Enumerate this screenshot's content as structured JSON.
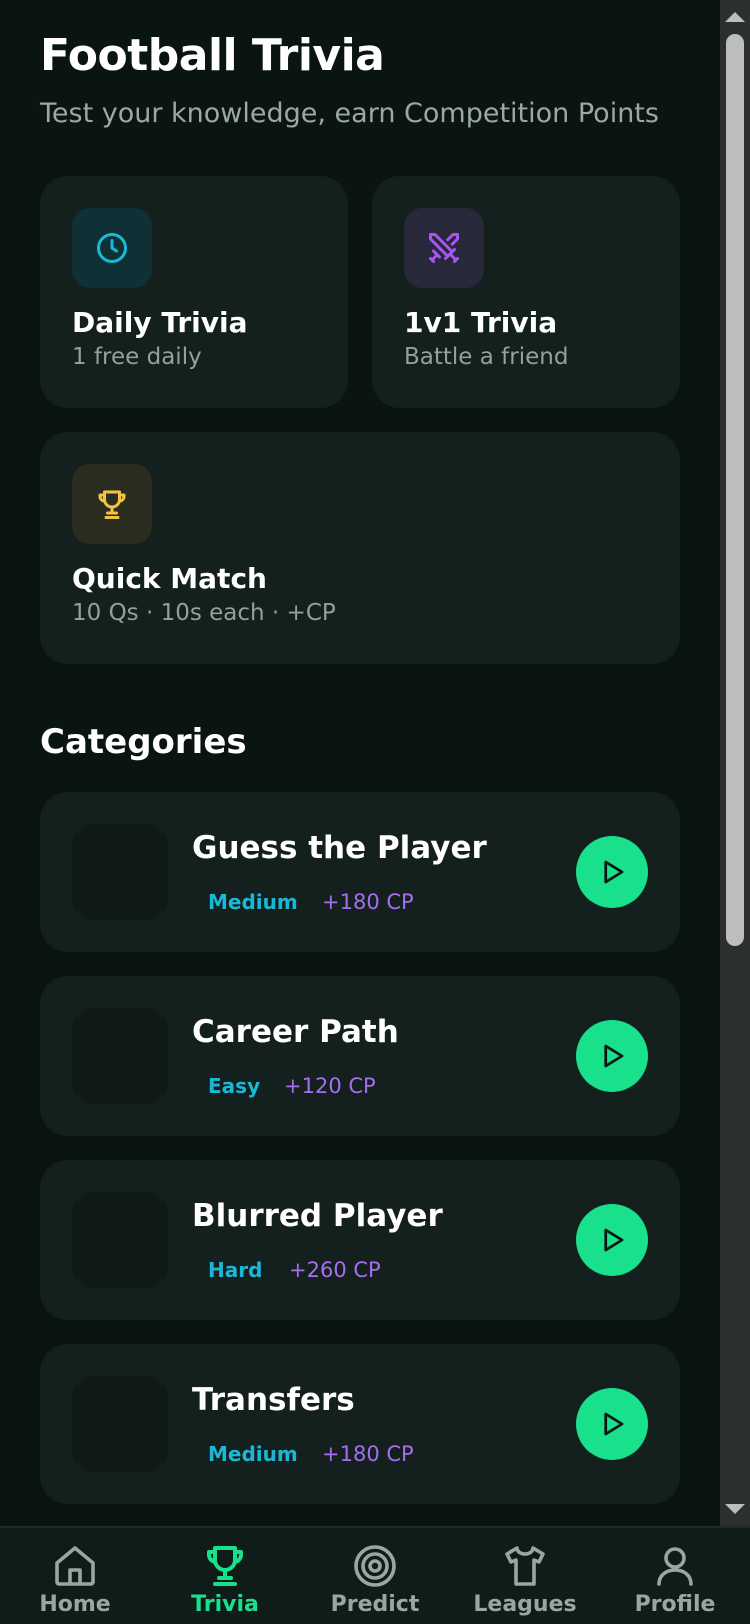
{
  "header": {
    "title": "Football Trivia",
    "subtitle": "Test your knowledge, earn Competition Points"
  },
  "modes": [
    {
      "title": "Daily Trivia",
      "subtitle": "1 free daily",
      "icon": "clock-icon",
      "icon_color": "#1ab8d6",
      "icon_bg": "#0f3035"
    },
    {
      "title": "1v1 Trivia",
      "subtitle": "Battle a friend",
      "icon": "crossed-swords-icon",
      "icon_color": "#a855f7",
      "icon_bg": "#27283a"
    },
    {
      "title": "Quick Match",
      "subtitle": "10 Qs · 10s each · +CP",
      "icon": "trophy-icon",
      "icon_color": "#f5c242",
      "icon_bg": "#2b2d21"
    }
  ],
  "categories_title": "Categories",
  "categories": [
    {
      "title": "Guess the Player",
      "difficulty": "Medium",
      "reward": "+180 CP"
    },
    {
      "title": "Career Path",
      "difficulty": "Easy",
      "reward": "+120 CP"
    },
    {
      "title": "Blurred Player",
      "difficulty": "Hard",
      "reward": "+260 CP"
    },
    {
      "title": "Transfers",
      "difficulty": "Medium",
      "reward": "+180 CP"
    }
  ],
  "nav": [
    {
      "label": "Home",
      "icon": "home-icon"
    },
    {
      "label": "Trivia",
      "icon": "trophy-icon",
      "active": true
    },
    {
      "label": "Predict",
      "icon": "target-icon"
    },
    {
      "label": "Leagues",
      "icon": "shirt-icon"
    },
    {
      "label": "Profile",
      "icon": "user-icon"
    }
  ],
  "colors": {
    "background": "#0a1412",
    "card": "#13201d",
    "accent_green": "#19e08a",
    "difficulty_blue": "#1ab8d6",
    "cp_purple": "#a76df0"
  }
}
